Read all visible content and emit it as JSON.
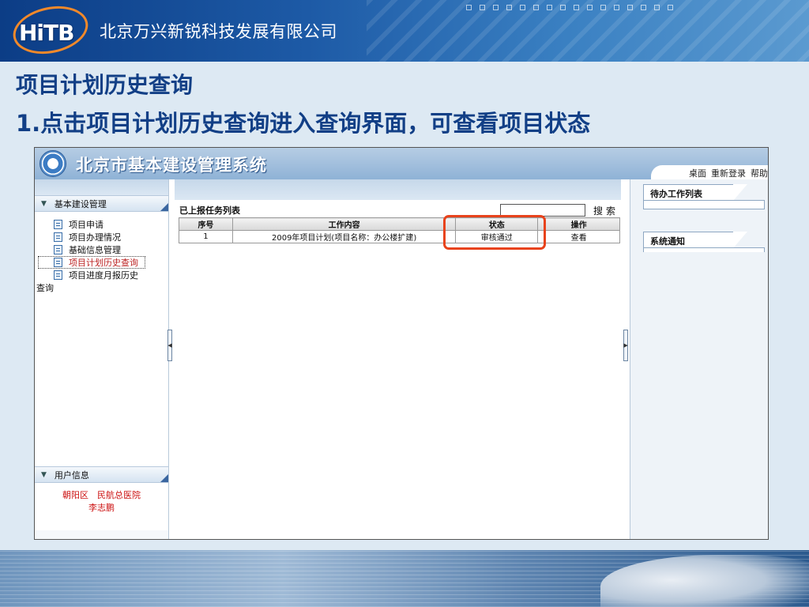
{
  "company": "北京万兴新锐科技发展有限公司",
  "logo_text": "HiTB",
  "slide": {
    "title": "项目计划历史查询",
    "subtitle": "1.点击项目计划历史查询进入查询界面，可查看项目状态"
  },
  "app": {
    "title": "北京市基本建设管理系统",
    "links": [
      "桌面",
      "重新登录",
      "帮助"
    ]
  },
  "left": {
    "section1": "基本建设管理",
    "items": [
      "项目申请",
      "项目办理情况",
      "基础信息管理",
      "项目计划历史查询",
      "项目进度月报历史"
    ],
    "wrap": "查询",
    "section2": "用户信息",
    "user_org": "朝阳区　民航总医院",
    "user_name": "李志鹏"
  },
  "task_list": {
    "title": "已上报任务列表",
    "search_label": "搜索",
    "search_value": "",
    "columns": [
      "序号",
      "工作内容",
      "状态",
      "操作"
    ],
    "rows": [
      {
        "no": "1",
        "content": "2009年项目计划(项目名称：办公楼扩建)",
        "status": "审核通过",
        "action": "查看"
      }
    ]
  },
  "right": {
    "todo": "待办工作列表",
    "notice": "系统通知"
  },
  "colors": {
    "title_blue": "#123f86",
    "highlight": "#e8431c",
    "active_item": "#bb2222"
  }
}
